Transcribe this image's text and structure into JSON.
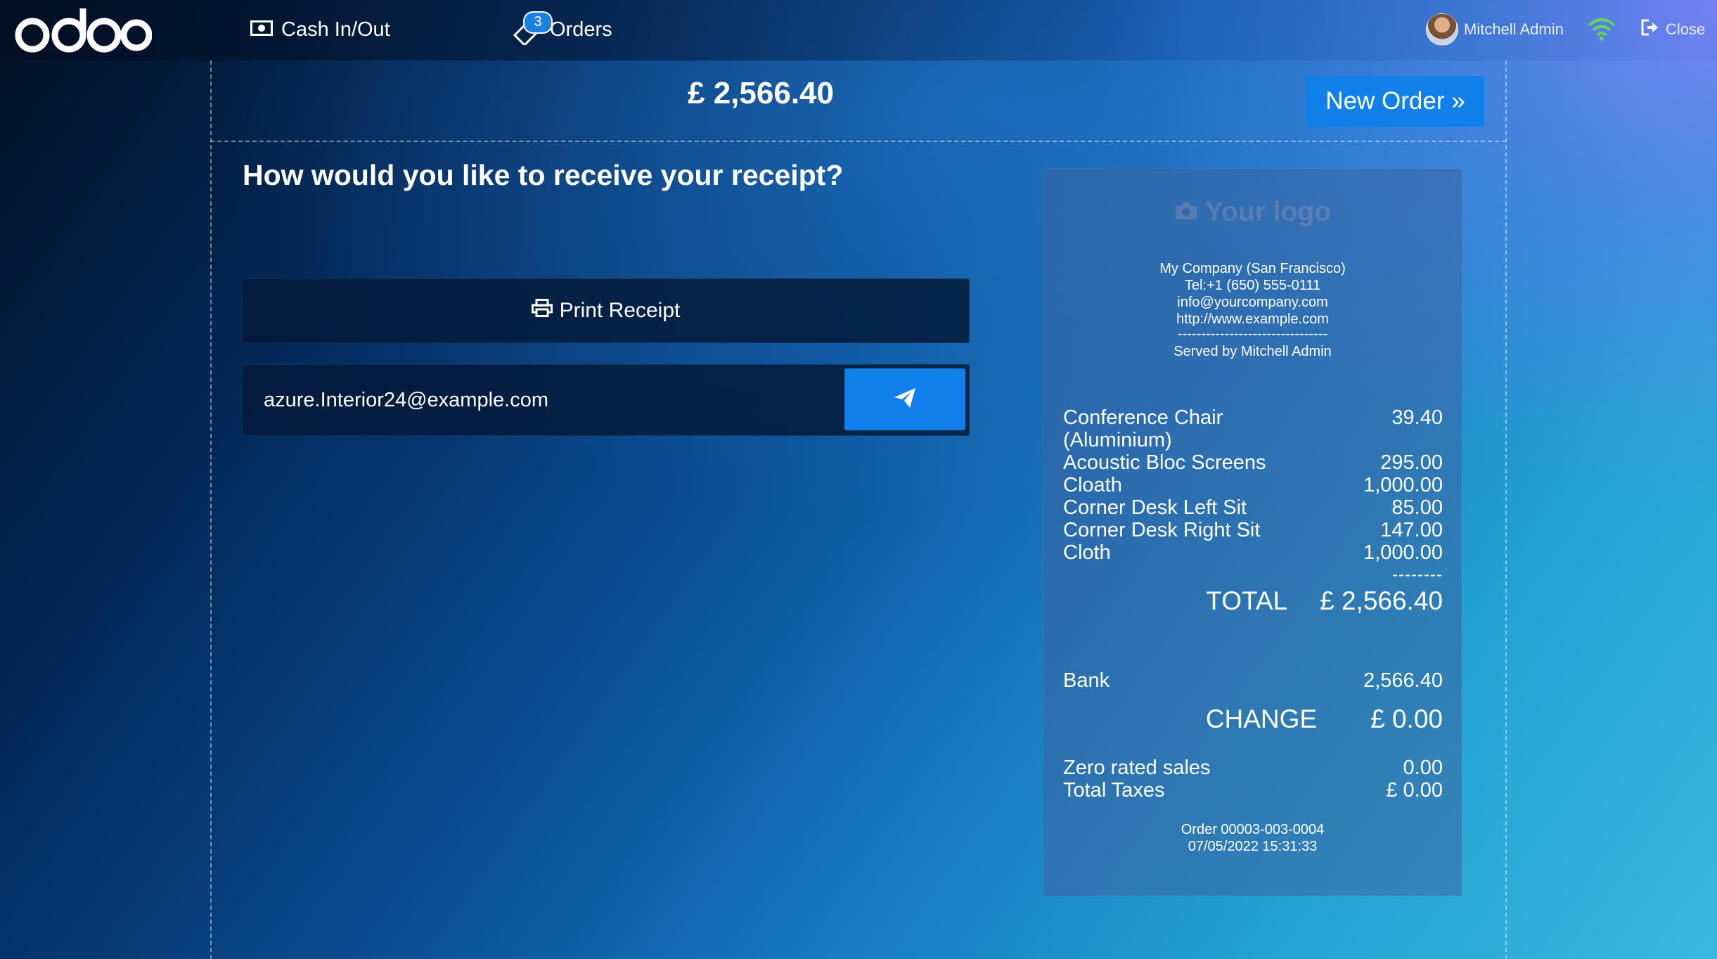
{
  "app": {
    "logo_text": "odoo"
  },
  "topbar": {
    "cash_inout_label": "Cash In/Out",
    "orders_label": "Orders",
    "orders_count": "3",
    "user_name": "Mitchell Admin",
    "close_label": "Close",
    "connection_color": "#5fd35f"
  },
  "payment": {
    "amount": "£ 2,566.40",
    "new_order_label": "New Order »"
  },
  "receipt_prompt": {
    "question": "How would you like to receive your receipt?",
    "print_label": "Print Receipt",
    "email_value": "azure.Interior24@example.com"
  },
  "receipt": {
    "logo_placeholder": "Your logo",
    "company_lines": [
      "My Company (San Francisco)",
      "Tel:+1 (650) 555-0111",
      "info@yourcompany.com",
      "http://www.example.com",
      "--------------------------------",
      "Served by Mitchell Admin"
    ],
    "lines": [
      {
        "name": "Conference Chair (Aluminium)",
        "price": "39.40"
      },
      {
        "name": "Acoustic Bloc Screens",
        "price": "295.00"
      },
      {
        "name": "Cloath",
        "price": "1,000.00"
      },
      {
        "name": "Corner Desk Left Sit",
        "price": "85.00"
      },
      {
        "name": "Corner Desk Right Sit",
        "price": "147.00"
      },
      {
        "name": "Cloth",
        "price": "1,000.00"
      }
    ],
    "divider": "--------",
    "total_label": "TOTAL",
    "total_value": "£ 2,566.40",
    "payment_method": "Bank",
    "payment_value": "2,566.40",
    "change_label": "CHANGE",
    "change_value": "£ 0.00",
    "taxes": [
      {
        "name": "Zero rated sales",
        "value": "0.00"
      },
      {
        "name": "Total Taxes",
        "value": "£ 0.00"
      }
    ],
    "order_ref": "Order 00003-003-0004",
    "order_datetime": "07/05/2022 15:31:33"
  },
  "colors": {
    "accent_button": "#1280ea",
    "dark_panel": "#031a3a"
  }
}
